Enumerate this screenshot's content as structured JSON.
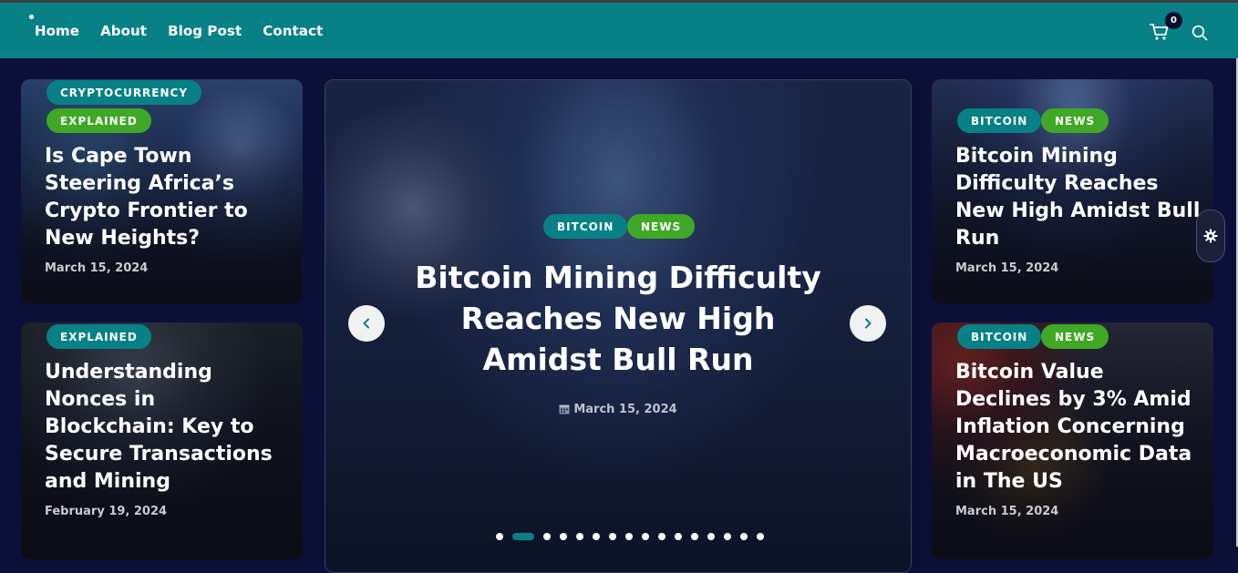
{
  "nav": {
    "items": [
      "Home",
      "About",
      "Blog Post",
      "Contact"
    ],
    "cart_count": "0",
    "icons": {
      "cart": "cart-icon",
      "search": "search-icon"
    }
  },
  "colors": {
    "teal": "#078185",
    "green": "#3fa826",
    "background": "#0c1038"
  },
  "left_cards": [
    {
      "categories": [
        "CRYPTOCURRENCY",
        "EXPLAINED"
      ],
      "title": "Is Cape Town Steering Africa’s Crypto Frontier to New Heights?",
      "date": "March 15, 2024"
    },
    {
      "categories": [
        "EXPLAINED"
      ],
      "title": "Understanding Nonces in Blockchain: Key to Secure Transactions and Mining",
      "date": "February 19, 2024"
    }
  ],
  "hero": {
    "categories": [
      "BITCOIN",
      "NEWS"
    ],
    "title": "Bitcoin Mining Difficulty Reaches New High Amidst Bull Run",
    "date": "March 15, 2024",
    "slide_count": 16,
    "active_slide": 2
  },
  "right_cards": [
    {
      "categories": [
        "BITCOIN",
        "NEWS"
      ],
      "title": "Bitcoin Mining Difficulty Reaches New High Amidst Bull Run",
      "date": "March 15, 2024"
    },
    {
      "categories": [
        "BITCOIN",
        "NEWS"
      ],
      "title": "Bitcoin Value Declines by 3% Amid Inflation Concerning Macroeconomic Data in The US",
      "date": "March 15, 2024"
    }
  ]
}
